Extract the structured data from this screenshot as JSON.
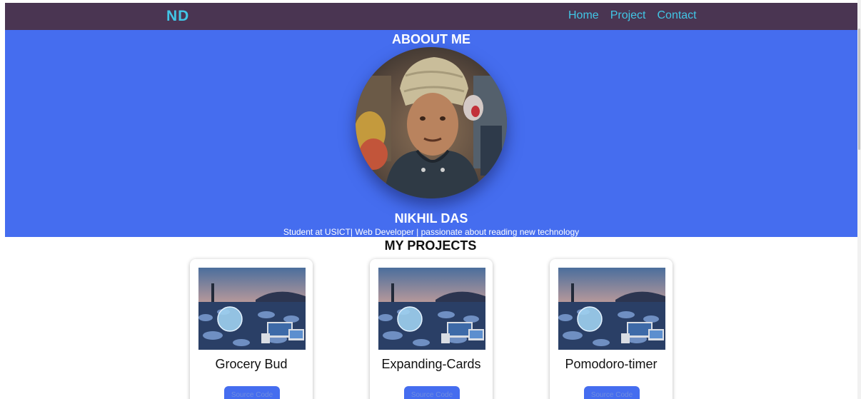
{
  "navbar": {
    "brand": "ND",
    "links": [
      "Home",
      "Project",
      "Contact"
    ]
  },
  "hero": {
    "title": "ABOOUT ME",
    "name": "NIKHIL DAS",
    "tagline": "Student at USICT| Web Developer | passionate about reading new technology"
  },
  "projects": {
    "title": "MY PROJECTS",
    "cards": [
      {
        "title": "Grocery Bud",
        "button": "Source Code"
      },
      {
        "title": "Expanding-Cards",
        "button": "Source Code"
      },
      {
        "title": "Pomodoro-timer",
        "button": "Source Code"
      }
    ]
  },
  "colors": {
    "navbar_bg": "#4a3552",
    "nav_text": "#41c6e6",
    "hero_bg": "#456def",
    "button_bg": "#456def"
  }
}
